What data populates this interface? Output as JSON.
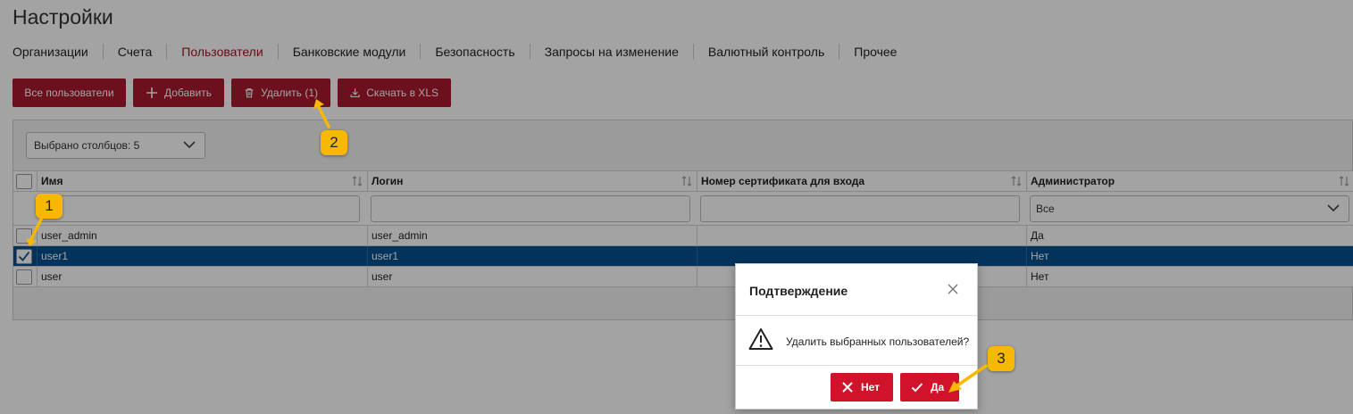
{
  "page": {
    "title": "Настройки"
  },
  "tabs": [
    {
      "label": "Организации",
      "active": false
    },
    {
      "label": "Счета",
      "active": false
    },
    {
      "label": "Пользователи",
      "active": true
    },
    {
      "label": "Банковские модули",
      "active": false
    },
    {
      "label": "Безопасность",
      "active": false
    },
    {
      "label": "Запросы на изменение",
      "active": false
    },
    {
      "label": "Валютный контроль",
      "active": false
    },
    {
      "label": "Прочее",
      "active": false
    }
  ],
  "toolbar": {
    "all_users_label": "Все пользователи",
    "add_label": "Добавить",
    "delete_label": "Удалить (1)",
    "export_label": "Скачать в XLS"
  },
  "columns_selector": {
    "value": "Выбрано столбцов: 5"
  },
  "table": {
    "columns": [
      "Имя",
      "Логин",
      "Номер сертификата для входа",
      "Администратор"
    ],
    "filters": {
      "admin_filter_value": "Все"
    },
    "rows": [
      {
        "name": "user_admin",
        "login": "user_admin",
        "cert": "",
        "admin": "Да",
        "checked": false,
        "selected": false
      },
      {
        "name": "user1",
        "login": "user1",
        "cert": "",
        "admin": "Нет",
        "checked": true,
        "selected": true
      },
      {
        "name": "user",
        "login": "user",
        "cert": "",
        "admin": "Нет",
        "checked": false,
        "selected": false
      }
    ]
  },
  "dialog": {
    "title": "Подтверждение",
    "message": "Удалить выбранных пользователей?",
    "no_label": "Нет",
    "yes_label": "Да"
  },
  "callouts": [
    "1",
    "2",
    "3"
  ],
  "colors": {
    "brand_red": "#a81a2c",
    "dialog_red": "#d0122b",
    "selected_row": "#05508f",
    "callout_yellow": "#f6b800"
  }
}
